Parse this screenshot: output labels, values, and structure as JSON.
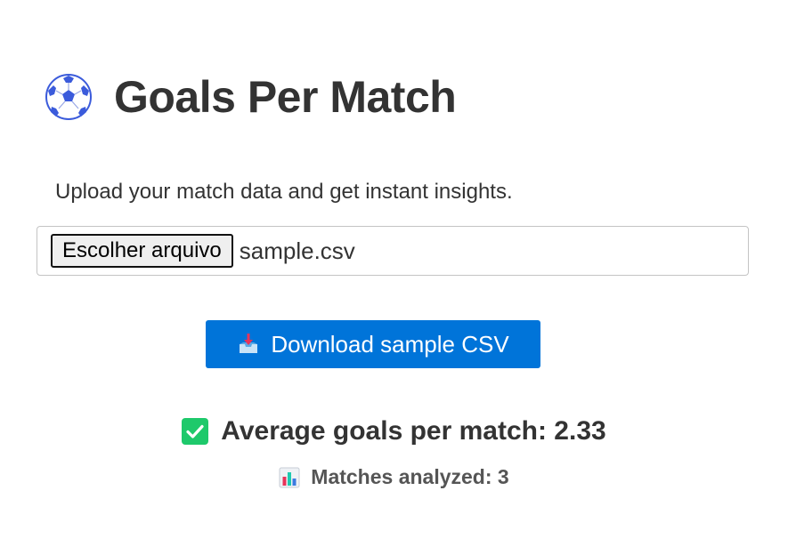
{
  "header": {
    "title": "Goals Per Match",
    "icon": "soccer-ball-icon"
  },
  "upload": {
    "description": "Upload your match data and get instant insights.",
    "button_label": "Escolher arquivo",
    "file_name": "sample.csv"
  },
  "download": {
    "label": "Download sample CSV",
    "icon": "inbox-tray-icon",
    "color": "#0074d9"
  },
  "results": {
    "average_text": "Average goals per match: 2.33",
    "average_icon": "check-mark-icon",
    "average_icon_color": "#1ec96b",
    "matches_text": "Matches analyzed: 3",
    "matches_icon": "bar-chart-icon"
  }
}
